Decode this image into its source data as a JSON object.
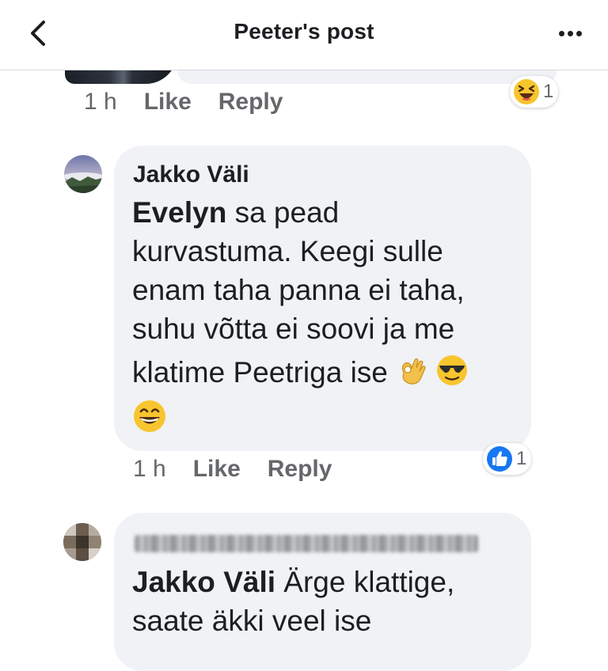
{
  "header": {
    "title": "Peeter's post"
  },
  "comment_prev": {
    "time": "1 h",
    "like": "Like",
    "reply": "Reply",
    "reaction_type": "laughing-emoji",
    "reaction_count": "1"
  },
  "comment_main": {
    "author": "Jakko Väli",
    "mention": "Evelyn",
    "line1_rest": " sa pead",
    "line2": "kurvastuma. Keegi sulle",
    "line3": "enam taha panna ei taha,",
    "line4": "suhu võtta ei soovi ja me",
    "line5": "klatime Peetriga ise",
    "emojis": [
      "ok-hand-emoji",
      "sunglasses-emoji",
      "grinning-emoji"
    ],
    "time": "1 h",
    "like": "Like",
    "reply": "Reply",
    "reaction_type": "like-icon",
    "reaction_count": "1"
  },
  "comment_next": {
    "mention": "Jakko Väli",
    "line1_rest": " Ärge klattige,",
    "line2": "saate äkki veel ise"
  }
}
